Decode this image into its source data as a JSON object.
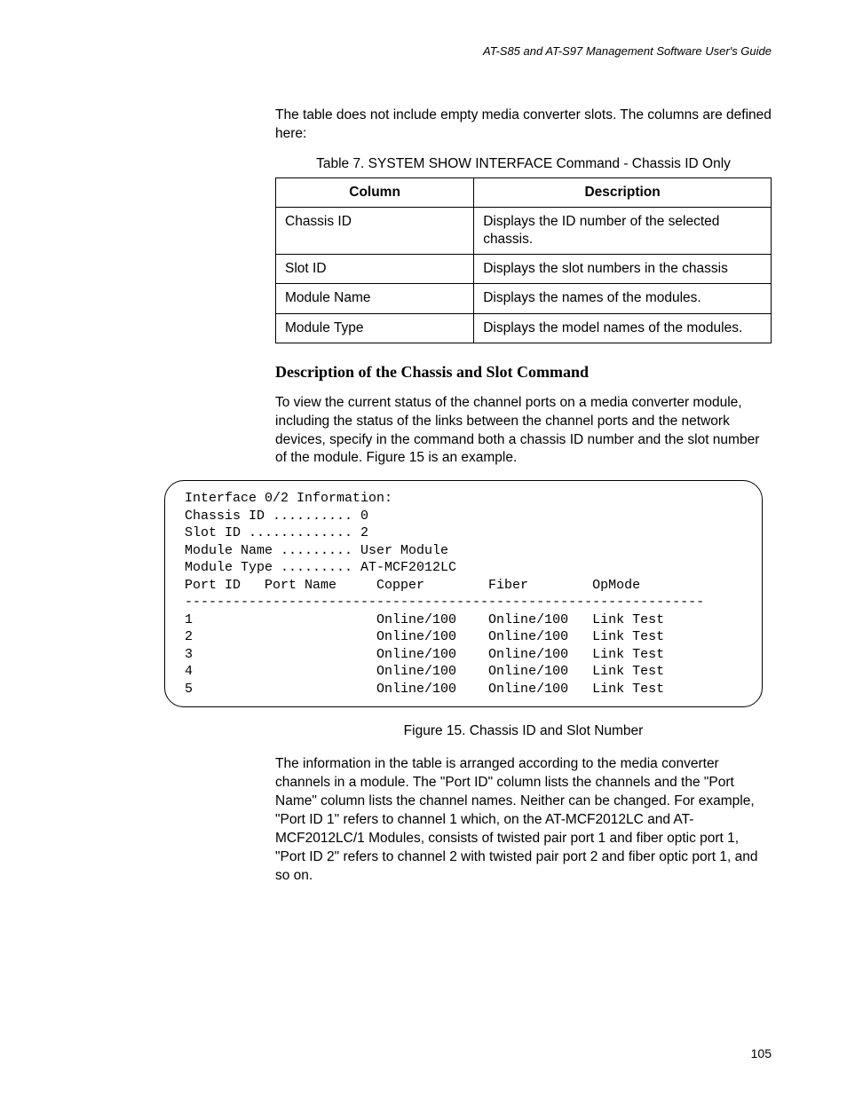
{
  "running_head": "AT-S85 and AT-S97 Management Software User's Guide",
  "intro_paragraph": "The table does not include empty media converter slots. The columns are defined here:",
  "table_caption": "Table 7. SYSTEM SHOW INTERFACE Command - Chassis ID Only",
  "table_headers": {
    "col1": "Column",
    "col2": "Description"
  },
  "table_rows": [
    {
      "col1": "Chassis ID",
      "col2": "Displays the ID number of the selected chassis."
    },
    {
      "col1": "Slot ID",
      "col2": "Displays the slot numbers in the chassis"
    },
    {
      "col1": "Module Name",
      "col2": "Displays the names of the modules."
    },
    {
      "col1": "Module Type",
      "col2": "Displays the model names of the modules."
    }
  ],
  "subheading": "Description of the Chassis and Slot Command",
  "sub_paragraph": "To view the current status of the channel ports on a media converter module, including the status of the links between the channel ports and the network devices, specify in the command both a chassis ID number and the slot number of the module. Figure 15 is an example.",
  "terminal": {
    "lines": [
      "Interface 0/2 Information:",
      "Chassis ID .......... 0",
      "Slot ID ............. 2",
      "Module Name ......... User Module",
      "Module Type ......... AT-MCF2012LC",
      "Port ID   Port Name     Copper        Fiber        OpMode",
      "-----------------------------------------------------------------",
      "1                       Online/100    Online/100   Link Test",
      "2                       Online/100    Online/100   Link Test",
      "3                       Online/100    Online/100   Link Test",
      "4                       Online/100    Online/100   Link Test",
      "5                       Online/100    Online/100   Link Test"
    ]
  },
  "figure_caption": "Figure 15. Chassis ID and Slot Number",
  "closing_paragraph": "The information in the table is arranged according to the media converter channels in a module. The \"Port ID\" column lists the channels and the \"Port Name\" column lists the channel names. Neither can be changed. For example, \"Port ID 1\" refers to channel 1 which, on the AT-MCF2012LC and AT-MCF2012LC/1 Modules, consists of twisted pair port 1 and fiber optic port 1, \"Port ID 2\" refers to channel 2 with twisted pair port 2 and fiber optic port 1, and so on.",
  "page_number": "105"
}
